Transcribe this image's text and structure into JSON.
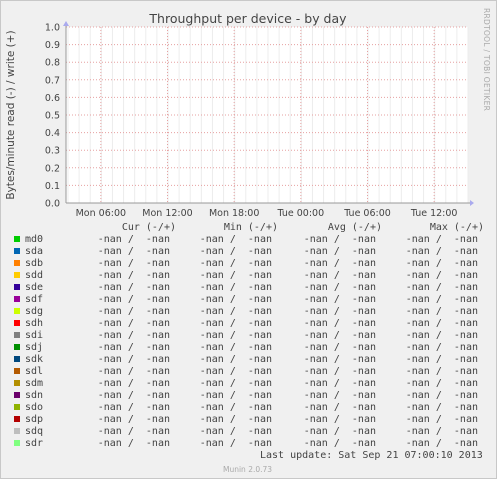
{
  "chart_data": {
    "type": "line",
    "title": "Throughput per device - by day",
    "ylabel": "Bytes/minute read (-) / write (+)",
    "ylim": [
      0,
      1
    ],
    "yticks": [
      "0.0",
      "0.1",
      "0.2",
      "0.3",
      "0.4",
      "0.5",
      "0.6",
      "0.7",
      "0.8",
      "0.9",
      "1.0"
    ],
    "xticks": [
      "Mon 06:00",
      "Mon 12:00",
      "Mon 18:00",
      "Tue 00:00",
      "Tue 06:00",
      "Tue 12:00"
    ],
    "grid": true,
    "side_label": "RRDTOOL / TOBI OETIKER",
    "series": []
  },
  "legend": {
    "headers": [
      "Cur (-/+)",
      "Min (-/+)",
      "Avg (-/+)",
      "Max (-/+)"
    ],
    "rows": [
      {
        "name": "md0",
        "color": "#00cc00",
        "cur": "-nan /  -nan",
        "min": "-nan /  -nan",
        "avg": "-nan /  -nan",
        "max": "-nan /  -nan"
      },
      {
        "name": "sda",
        "color": "#0066b3",
        "cur": "-nan /  -nan",
        "min": "-nan /  -nan",
        "avg": "-nan /  -nan",
        "max": "-nan /  -nan"
      },
      {
        "name": "sdb",
        "color": "#ff8000",
        "cur": "-nan /  -nan",
        "min": "-nan /  -nan",
        "avg": "-nan /  -nan",
        "max": "-nan /  -nan"
      },
      {
        "name": "sdd",
        "color": "#ffcc00",
        "cur": "-nan /  -nan",
        "min": "-nan /  -nan",
        "avg": "-nan /  -nan",
        "max": "-nan /  -nan"
      },
      {
        "name": "sde",
        "color": "#330099",
        "cur": "-nan /  -nan",
        "min": "-nan /  -nan",
        "avg": "-nan /  -nan",
        "max": "-nan /  -nan"
      },
      {
        "name": "sdf",
        "color": "#990099",
        "cur": "-nan /  -nan",
        "min": "-nan /  -nan",
        "avg": "-nan /  -nan",
        "max": "-nan /  -nan"
      },
      {
        "name": "sdg",
        "color": "#ccff00",
        "cur": "-nan /  -nan",
        "min": "-nan /  -nan",
        "avg": "-nan /  -nan",
        "max": "-nan /  -nan"
      },
      {
        "name": "sdh",
        "color": "#ff0000",
        "cur": "-nan /  -nan",
        "min": "-nan /  -nan",
        "avg": "-nan /  -nan",
        "max": "-nan /  -nan"
      },
      {
        "name": "sdi",
        "color": "#808080",
        "cur": "-nan /  -nan",
        "min": "-nan /  -nan",
        "avg": "-nan /  -nan",
        "max": "-nan /  -nan"
      },
      {
        "name": "sdj",
        "color": "#008f00",
        "cur": "-nan /  -nan",
        "min": "-nan /  -nan",
        "avg": "-nan /  -nan",
        "max": "-nan /  -nan"
      },
      {
        "name": "sdk",
        "color": "#00487d",
        "cur": "-nan /  -nan",
        "min": "-nan /  -nan",
        "avg": "-nan /  -nan",
        "max": "-nan /  -nan"
      },
      {
        "name": "sdl",
        "color": "#b35a00",
        "cur": "-nan /  -nan",
        "min": "-nan /  -nan",
        "avg": "-nan /  -nan",
        "max": "-nan /  -nan"
      },
      {
        "name": "sdm",
        "color": "#b38f00",
        "cur": "-nan /  -nan",
        "min": "-nan /  -nan",
        "avg": "-nan /  -nan",
        "max": "-nan /  -nan"
      },
      {
        "name": "sdn",
        "color": "#6b006b",
        "cur": "-nan /  -nan",
        "min": "-nan /  -nan",
        "avg": "-nan /  -nan",
        "max": "-nan /  -nan"
      },
      {
        "name": "sdo",
        "color": "#8fb300",
        "cur": "-nan /  -nan",
        "min": "-nan /  -nan",
        "avg": "-nan /  -nan",
        "max": "-nan /  -nan"
      },
      {
        "name": "sdp",
        "color": "#b30000",
        "cur": "-nan /  -nan",
        "min": "-nan /  -nan",
        "avg": "-nan /  -nan",
        "max": "-nan /  -nan"
      },
      {
        "name": "sdq",
        "color": "#bebebe",
        "cur": "-nan /  -nan",
        "min": "-nan /  -nan",
        "avg": "-nan /  -nan",
        "max": "-nan /  -nan"
      },
      {
        "name": "sdr",
        "color": "#80ff80",
        "cur": "-nan /  -nan",
        "min": "-nan /  -nan",
        "avg": "-nan /  -nan",
        "max": "-nan /  -nan"
      }
    ]
  },
  "footer": {
    "last_update": "Last update: Sat Sep 21 07:00:10 2013",
    "version": "Munin 2.0.73"
  },
  "colors": {
    "background": "#f0f0f0",
    "plot_background": "#ffffff",
    "grid_major": "#e6a0a0",
    "grid_minor": "#ececec",
    "text": "#444444"
  }
}
